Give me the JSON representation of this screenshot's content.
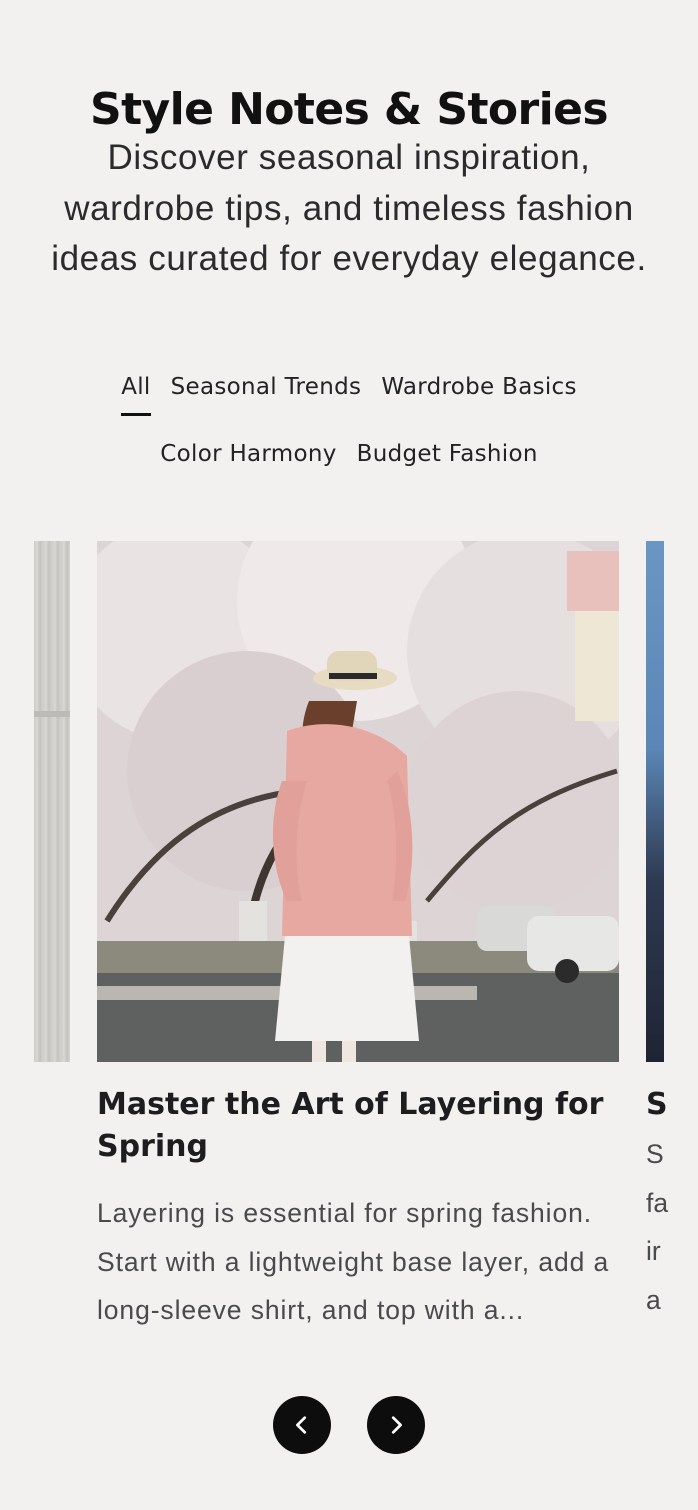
{
  "header": {
    "title": "Style Notes & Stories",
    "subtitle": "Discover seasonal inspiration, wardrobe tips, and timeless fashion ideas curated for everyday elegance."
  },
  "tabs": [
    {
      "label": "All",
      "active": true
    },
    {
      "label": "Seasonal Trends",
      "active": false
    },
    {
      "label": "Wardrobe Basics",
      "active": false
    },
    {
      "label": "Color Harmony",
      "active": false
    },
    {
      "label": "Budget Fashion",
      "active": false
    }
  ],
  "carousel": {
    "active_card": {
      "title": "Master the Art of Layering for Spring",
      "excerpt": "Layering is essential for spring fashion. Start with a lightweight base layer, add a long-sleeve shirt, and top with a..."
    },
    "next_card_peek": {
      "title": "S",
      "excerpt": "S fa ir a"
    },
    "prev_button_icon": "chevron-left-icon",
    "next_button_icon": "chevron-right-icon"
  },
  "colors": {
    "background": "#f2f1f0",
    "text": "#111111",
    "button": "#0d0d0d"
  }
}
